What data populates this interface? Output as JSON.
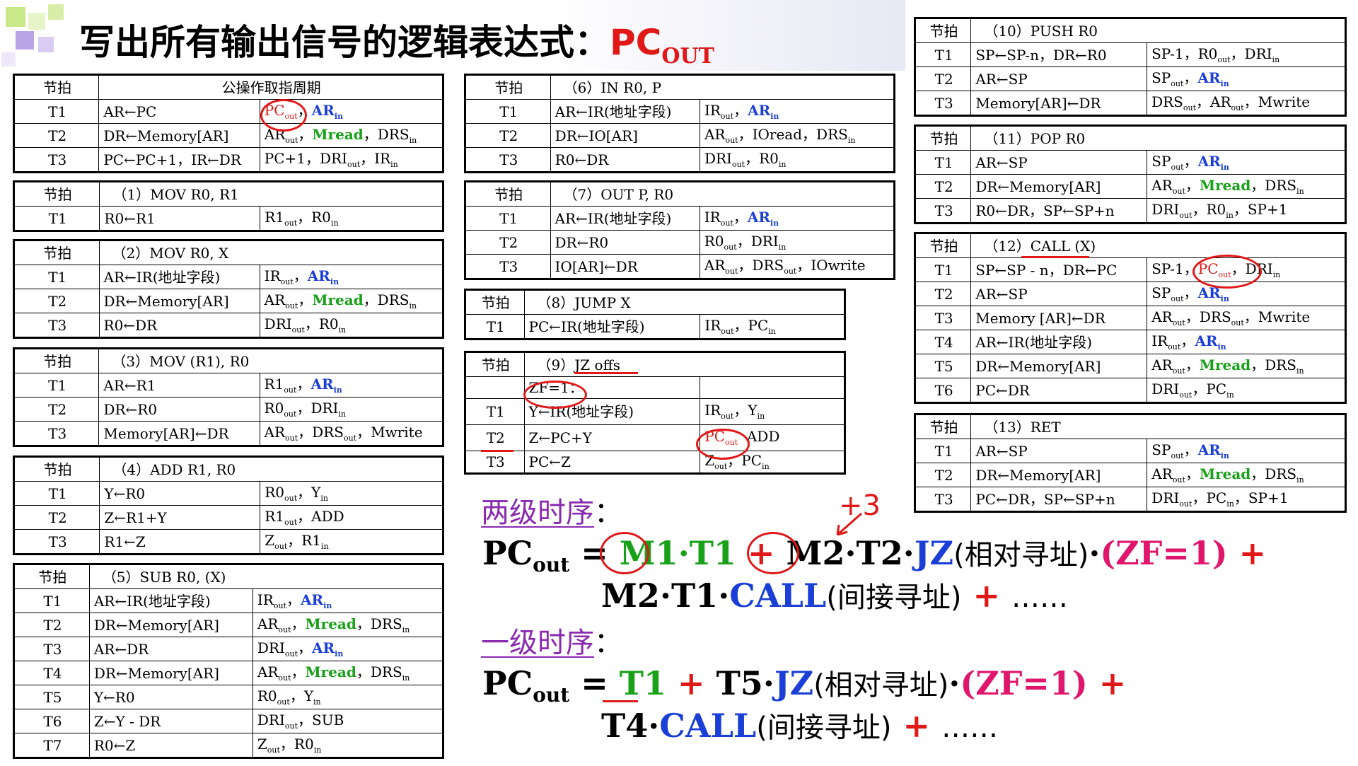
{
  "title": {
    "main": "写出所有输出信号的逻辑表达式：",
    "pc": "PC",
    "sub": "OUT"
  },
  "tables": {
    "fetch": {
      "header": [
        "节拍",
        "公操作取指周期"
      ],
      "rows": [
        [
          "T1",
          "AR←PC",
          "PCout，ARin"
        ],
        [
          "T2",
          "DR←Memory[AR]",
          "ARout，Mread，DRSin"
        ],
        [
          "T3",
          "PC←PC+1，IR←DR",
          "PC+1，DRIout，IRin"
        ]
      ]
    },
    "t1": {
      "header": [
        "节拍",
        "（1）MOV R0, R1"
      ],
      "rows": [
        [
          "T1",
          "R0←R1",
          "R1out，R0in"
        ]
      ]
    },
    "t2": {
      "header": [
        "节拍",
        "（2）MOV R0, X"
      ],
      "rows": [
        [
          "T1",
          "AR←IR(地址字段)",
          "IRout，ARin"
        ],
        [
          "T2",
          "DR←Memory[AR]",
          "ARout，Mread，DRSin"
        ],
        [
          "T3",
          "R0←DR",
          "DRIout，R0in"
        ]
      ]
    },
    "t3": {
      "header": [
        "节拍",
        "（3）MOV (R1), R0"
      ],
      "rows": [
        [
          "T1",
          "AR←R1",
          "R1out，ARin"
        ],
        [
          "T2",
          "DR←R0",
          "R0out，DRIin"
        ],
        [
          "T3",
          "Memory[AR]←DR",
          "ARout，DRSout，Mwrite"
        ]
      ]
    },
    "t4": {
      "header": [
        "节拍",
        "（4）ADD R1, R0"
      ],
      "rows": [
        [
          "T1",
          "Y←R0",
          "R0out，Yin"
        ],
        [
          "T2",
          "Z←R1+Y",
          "R1out，ADD"
        ],
        [
          "T3",
          "R1←Z",
          "Zout，R1in"
        ]
      ]
    },
    "t5": {
      "header": [
        "节拍",
        "（5）SUB R0, (X)"
      ],
      "rows": [
        [
          "T1",
          "AR←IR(地址字段)",
          "IRout，ARin"
        ],
        [
          "T2",
          "DR←Memory[AR]",
          "ARout，Mread，DRSin"
        ],
        [
          "T3",
          "AR←DR",
          "DRIout，ARin"
        ],
        [
          "T4",
          "DR←Memory[AR]",
          "ARout，Mread，DRSin"
        ],
        [
          "T5",
          "Y←R0",
          "R0out，Yin"
        ],
        [
          "T6",
          "Z←Y - DR",
          "DRIout，SUB"
        ],
        [
          "T7",
          "R0←Z",
          "Zout，R0in"
        ]
      ]
    },
    "t6": {
      "header": [
        "节拍",
        "（6）IN R0, P"
      ],
      "rows": [
        [
          "T1",
          "AR←IR(地址字段)",
          "IRout，ARin"
        ],
        [
          "T2",
          "DR←IO[AR]",
          "ARout，IOread，DRSin"
        ],
        [
          "T3",
          "R0←DR",
          "DRIout，R0in"
        ]
      ]
    },
    "t7": {
      "header": [
        "节拍",
        "（7）OUT P, R0"
      ],
      "rows": [
        [
          "T1",
          "AR←IR(地址字段)",
          "IRout，ARin"
        ],
        [
          "T2",
          "DR←R0",
          "R0out，DRIin"
        ],
        [
          "T3",
          "IO[AR]←DR",
          "ARout，DRSout，IOwrite"
        ]
      ]
    },
    "t8": {
      "header": [
        "节拍",
        "（8）JUMP X"
      ],
      "rows": [
        [
          "T1",
          "PC←IR(地址字段)",
          "IRout，PCin"
        ]
      ]
    },
    "t9": {
      "header": [
        "节拍",
        "（9）JZ offs"
      ],
      "rows": [
        [
          "",
          "ZF=1：",
          ""
        ],
        [
          "T1",
          "Y←IR(地址字段)",
          "IRout，Yin"
        ],
        [
          "T2",
          "Z←PC+Y",
          "PCout  ADD"
        ],
        [
          "T3",
          "PC←Z",
          "Zout，PCin"
        ]
      ]
    },
    "t10": {
      "header": [
        "节拍",
        "（10）PUSH R0"
      ],
      "rows": [
        [
          "T1",
          "SP←SP-n，DR←R0",
          "SP-1，R0out，DRIin"
        ],
        [
          "T2",
          "AR←SP",
          "SPout，ARin"
        ],
        [
          "T3",
          "Memory[AR]←DR",
          "DRSout，ARout，Mwrite"
        ]
      ]
    },
    "t11": {
      "header": [
        "节拍",
        "（11）POP R0"
      ],
      "rows": [
        [
          "T1",
          "AR←SP",
          "SPout，ARin"
        ],
        [
          "T2",
          "DR←Memory[AR]",
          "ARout，Mread，DRSin"
        ],
        [
          "T3",
          "R0←DR，SP←SP+n",
          "DRIout，R0in，SP+1"
        ]
      ]
    },
    "t12": {
      "header": [
        "节拍",
        "（12）CALL (X)"
      ],
      "rows": [
        [
          "T1",
          "SP←SP - n，DR←PC",
          "SP-1，PCout，DRIin"
        ],
        [
          "T2",
          "AR←SP",
          "SPout，ARin"
        ],
        [
          "T3",
          "Memory [AR]←DR",
          "ARout，DRSout，Mwrite"
        ],
        [
          "T4",
          "AR←IR(地址字段)",
          "IRout，ARin"
        ],
        [
          "T5",
          "DR←Memory[AR]",
          "ARout，Mread，DRSin"
        ],
        [
          "T6",
          "PC←DR",
          "DRIout，PCin"
        ]
      ]
    },
    "t13": {
      "header": [
        "节拍",
        "（13）RET"
      ],
      "rows": [
        [
          "T1",
          "AR←SP",
          "SPout，ARin"
        ],
        [
          "T2",
          "DR←Memory[AR]",
          "ARout，Mread，DRSin"
        ],
        [
          "T3",
          "PC←DR，SP←SP+n",
          "DRIout，PCin，SP+1"
        ]
      ]
    }
  },
  "sections": {
    "two_level": "两级时序",
    "one_level": "一级时序",
    "colon": "："
  },
  "formulas": {
    "pc": "PC",
    "out": "out",
    "eq": "=",
    "plus": "+",
    "dot": "·",
    "dots": "……",
    "m1": "M1",
    "m2": "M2",
    "t1": "T1",
    "t2": "T2",
    "t4": "T4",
    "t5": "T5",
    "jz": "JZ",
    "call": "CALL",
    "rel": "(相对寻址)",
    "ind": "(间接寻址)",
    "zf": "ZF=1",
    "lp": "(",
    "rp": ")",
    "annotation": "+3"
  },
  "colors": {
    "green": "#18a018",
    "blue": "#1b3fd6",
    "red": "#e01818",
    "pink": "#e0166c",
    "purple": "#8a2ab0"
  }
}
